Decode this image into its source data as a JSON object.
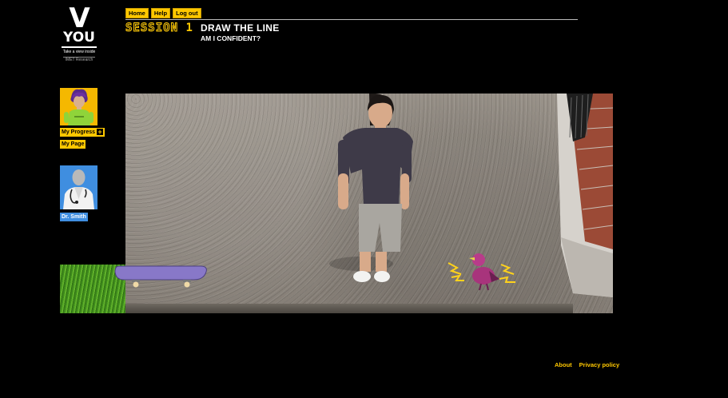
{
  "logo": {
    "letter": "V",
    "word": "YOU",
    "tagline": "Take a view inside",
    "org": "IMET Research"
  },
  "nav": {
    "home": "Home",
    "help": "Help",
    "logout": "Log out"
  },
  "session": {
    "label": "SESSION",
    "number": "1",
    "title": "DRAW THE LINE",
    "subtitle": "AM I CONFIDENT?"
  },
  "sidebar": {
    "progress_label": "My Progress",
    "progress_plus": "+",
    "mypage_label": "My Page",
    "doctor_label": "Dr. Smith"
  },
  "footer": {
    "about": "About",
    "privacy": "Privacy policy"
  },
  "colors": {
    "accent": "#ffc800",
    "doctor": "#3f8ee0",
    "background": "#000000"
  }
}
